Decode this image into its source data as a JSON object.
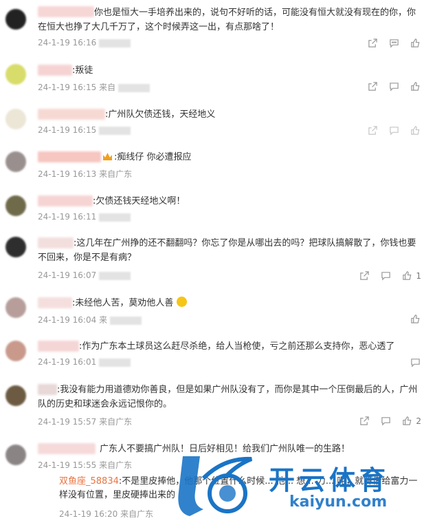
{
  "comments": [
    {
      "text": "你也是恒大一手培养出来的，说句不好听的话，可能没有恒大就没有现在的你，你在恒大也挣了大几千万了，这个时候弄这一出，有点那啥了！",
      "time": "24-1-19 16:16",
      "loc": ""
    },
    {
      "text": ":叛徒",
      "time": "24-1-19 16:15",
      "loc": "来自"
    },
    {
      "text": ":广州队欠债还钱，天经地义",
      "time": "24-1-19 16:15",
      "loc": ""
    },
    {
      "text": ":痴线仔 你必遭报应",
      "time": "24-1-19 16:13",
      "loc": "来自广东"
    },
    {
      "text": ":欠债还钱天经地义啊！",
      "time": "24-1-19 16:11",
      "loc": ""
    },
    {
      "text": ":这几年在广州挣的还不翻翻吗？你忘了你是从哪出去的吗？把球队搞解散了，你钱也要不回来，你是不是有病？",
      "time": "24-1-19 16:07",
      "loc": "",
      "likes": "1"
    },
    {
      "text": ":未经他人苦，莫劝他人善",
      "time": "24-1-19 16:04",
      "loc": "来"
    },
    {
      "text": ":作为广东本土球员这么赶尽杀绝，给人当枪使，亏之前还那么支持你，恶心透了",
      "time": "24-1-19 16:01",
      "loc": ""
    },
    {
      "text": ":我没有能力用道德劝你善良，但是如果广州队没有了，而你是其中一个压倒最后的人，广州队的历史和球迷会永远记恨你的。",
      "time": "24-1-19 15:57",
      "loc": "来自广东",
      "likes": "2"
    },
    {
      "text": "广东人不要搞广州队！日后好相见！给我们广州队唯一的生路！",
      "time": "24-1-19 15:55",
      "loc": "来自广东"
    }
  ],
  "reply": {
    "name": "双鱼座_58834",
    "text": ":不是里皮捧他，他那个位置什么时候... 他... 想... 力... 呢，就算借给富力一样没有位置，里皮硬捧出来的",
    "time": "24-1-19 16:20",
    "loc": "来自广东"
  },
  "watermark": {
    "cn": "开云体育",
    "en": "kaiyun.com"
  },
  "colors": {
    "reply_name": "#eb7340",
    "meta": "#999999",
    "watermark": "#1a74c6"
  }
}
